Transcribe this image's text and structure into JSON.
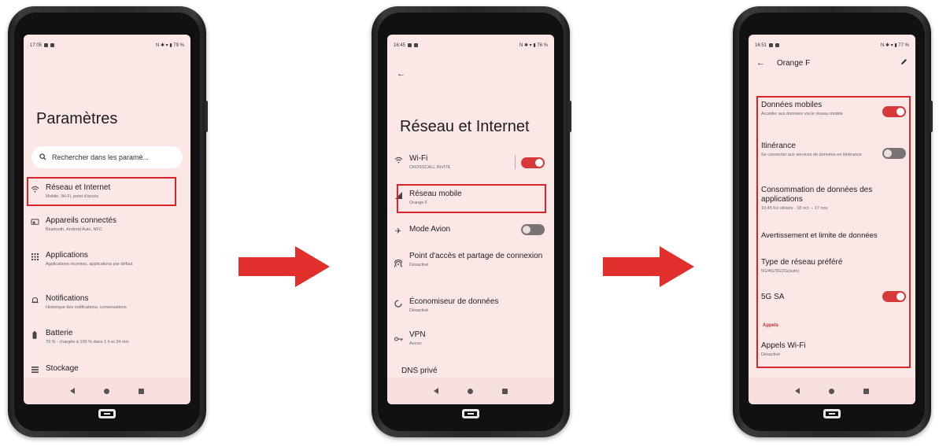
{
  "colors": {
    "accent": "#d9383a",
    "highlight": "#d8242b",
    "screen_bg": "#fbe7e5",
    "arrow": "#e1302c"
  },
  "phone1": {
    "status_time": "17:05",
    "status_right": "N ✱ ▾ ▮ 79 %",
    "title": "Paramètres",
    "search_placeholder": "Rechercher dans les paramè...",
    "items": [
      {
        "icon": "wifi-icon",
        "title": "Réseau et Internet",
        "sub": "Mobile, Wi-Fi, point d'accès"
      },
      {
        "icon": "devices-icon",
        "title": "Appareils connectés",
        "sub": "Bluetooth, Android Auto, NFC"
      },
      {
        "icon": "apps-grid-icon",
        "title": "Applications",
        "sub": "Applications récentes, applications par défaut"
      },
      {
        "icon": "bell-icon",
        "title": "Notifications",
        "sub": "Historique des notifications, conversations"
      },
      {
        "icon": "battery-icon",
        "title": "Batterie",
        "sub": "79 % - chargée à 100 % dans 1 h et 34 min"
      },
      {
        "icon": "storage-icon",
        "title": "Stockage",
        "sub": ""
      }
    ]
  },
  "phone2": {
    "status_time": "16:45",
    "status_right": "N ✱ ▾ ▮ 76 %",
    "title": "Réseau et Internet",
    "items": [
      {
        "icon": "wifi-icon",
        "title": "Wi-Fi",
        "sub": "CROSSCALL INVITE",
        "toggle": "on"
      },
      {
        "icon": "signal-icon",
        "title": "Réseau mobile",
        "sub": "Orange F"
      },
      {
        "icon": "airplane-icon",
        "title": "Mode Avion",
        "sub": "",
        "toggle": "off"
      },
      {
        "icon": "hotspot-icon",
        "title": "Point d'accès et partage de connexion",
        "sub": "Désactivé"
      },
      {
        "icon": "data-saver-icon",
        "title": "Économiseur de données",
        "sub": "Désactivé"
      },
      {
        "icon": "vpn-key-icon",
        "title": "VPN",
        "sub": "Aucun"
      },
      {
        "icon": "",
        "title": "DNS privé",
        "sub": ""
      }
    ]
  },
  "phone3": {
    "status_time": "16:51",
    "status_right": "N ✱ ▾ ▮ 77 %",
    "title": "Orange F",
    "items": [
      {
        "title": "Données mobiles",
        "sub": "Accéder aux données via le réseau mobile",
        "toggle": "on"
      },
      {
        "title": "Itinérance",
        "sub": "Se connecter aux services de données en itinérance",
        "toggle": "off"
      },
      {
        "title": "Consommation de données des applications",
        "sub": "10,45 Ko utilisés · 18 oct. – 17 nov."
      },
      {
        "title": "Avertissement et limite de données",
        "sub": ""
      },
      {
        "title": "Type de réseau préféré",
        "sub": "5G/4G/3G/2G(auto)"
      },
      {
        "title": "5G SA",
        "sub": "",
        "toggle": "on"
      }
    ],
    "section": "Appels",
    "calls": {
      "title": "Appels Wi-Fi",
      "sub": "Désactivé"
    }
  }
}
